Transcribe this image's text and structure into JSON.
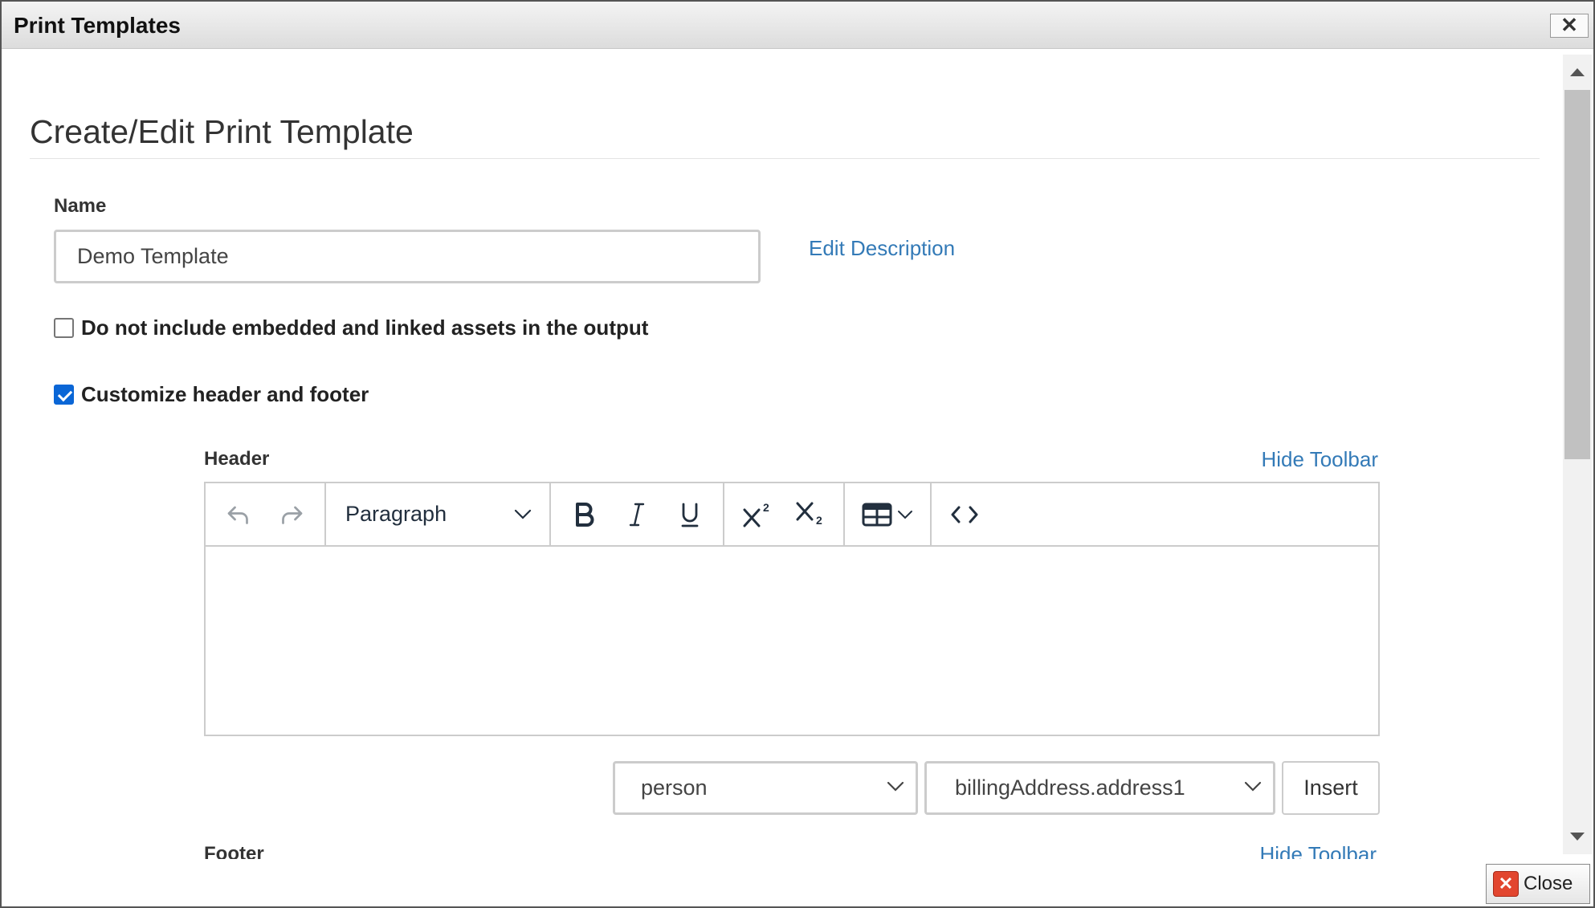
{
  "window": {
    "title": "Print Templates",
    "close_x": "✕"
  },
  "page": {
    "heading": "Create/Edit Print Template"
  },
  "form": {
    "name_label": "Name",
    "name_value": "Demo Template",
    "edit_description": "Edit Description",
    "exclude_assets_label": "Do not include embedded and linked assets in the output",
    "exclude_assets_checked": false,
    "customize_label": "Customize header and footer",
    "customize_checked": true
  },
  "header_section": {
    "label": "Header",
    "hide_toolbar": "Hide Toolbar",
    "toolbar": {
      "undo_icon": "undo-icon",
      "redo_icon": "redo-icon",
      "block_format": "Paragraph",
      "bold_icon": "bold-icon",
      "italic_icon": "italic-icon",
      "underline_icon": "underline-icon",
      "superscript_icon": "superscript-icon",
      "subscript_icon": "subscript-icon",
      "table_icon": "table-icon",
      "code_icon": "source-code-icon"
    },
    "content": ""
  },
  "insert_row": {
    "object_select": "person",
    "field_select": "billingAddress.address1",
    "insert_label": "Insert"
  },
  "footer_section": {
    "label": "Footer",
    "hide_toolbar": "Hide Toolbar"
  },
  "footer_bar": {
    "close_label": "Close"
  },
  "colors": {
    "link": "#337ab7",
    "checkbox_checked": "#0a66d6",
    "close_icon": "#e2462f"
  }
}
